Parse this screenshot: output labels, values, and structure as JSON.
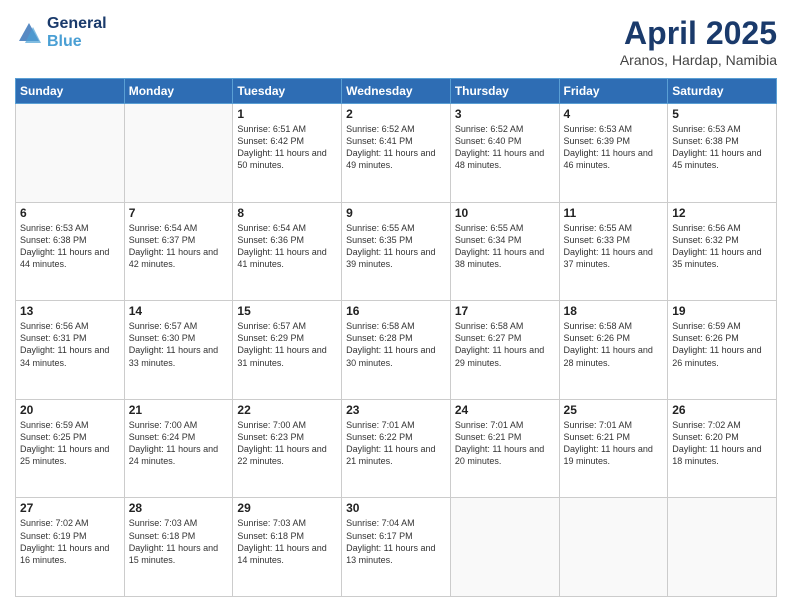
{
  "header": {
    "logo_line1": "General",
    "logo_line2": "Blue",
    "month_title": "April 2025",
    "subtitle": "Aranos, Hardap, Namibia"
  },
  "days_of_week": [
    "Sunday",
    "Monday",
    "Tuesday",
    "Wednesday",
    "Thursday",
    "Friday",
    "Saturday"
  ],
  "weeks": [
    [
      {
        "day": "",
        "sunrise": "",
        "sunset": "",
        "daylight": ""
      },
      {
        "day": "",
        "sunrise": "",
        "sunset": "",
        "daylight": ""
      },
      {
        "day": "1",
        "sunrise": "Sunrise: 6:51 AM",
        "sunset": "Sunset: 6:42 PM",
        "daylight": "Daylight: 11 hours and 50 minutes."
      },
      {
        "day": "2",
        "sunrise": "Sunrise: 6:52 AM",
        "sunset": "Sunset: 6:41 PM",
        "daylight": "Daylight: 11 hours and 49 minutes."
      },
      {
        "day": "3",
        "sunrise": "Sunrise: 6:52 AM",
        "sunset": "Sunset: 6:40 PM",
        "daylight": "Daylight: 11 hours and 48 minutes."
      },
      {
        "day": "4",
        "sunrise": "Sunrise: 6:53 AM",
        "sunset": "Sunset: 6:39 PM",
        "daylight": "Daylight: 11 hours and 46 minutes."
      },
      {
        "day": "5",
        "sunrise": "Sunrise: 6:53 AM",
        "sunset": "Sunset: 6:38 PM",
        "daylight": "Daylight: 11 hours and 45 minutes."
      }
    ],
    [
      {
        "day": "6",
        "sunrise": "Sunrise: 6:53 AM",
        "sunset": "Sunset: 6:38 PM",
        "daylight": "Daylight: 11 hours and 44 minutes."
      },
      {
        "day": "7",
        "sunrise": "Sunrise: 6:54 AM",
        "sunset": "Sunset: 6:37 PM",
        "daylight": "Daylight: 11 hours and 42 minutes."
      },
      {
        "day": "8",
        "sunrise": "Sunrise: 6:54 AM",
        "sunset": "Sunset: 6:36 PM",
        "daylight": "Daylight: 11 hours and 41 minutes."
      },
      {
        "day": "9",
        "sunrise": "Sunrise: 6:55 AM",
        "sunset": "Sunset: 6:35 PM",
        "daylight": "Daylight: 11 hours and 39 minutes."
      },
      {
        "day": "10",
        "sunrise": "Sunrise: 6:55 AM",
        "sunset": "Sunset: 6:34 PM",
        "daylight": "Daylight: 11 hours and 38 minutes."
      },
      {
        "day": "11",
        "sunrise": "Sunrise: 6:55 AM",
        "sunset": "Sunset: 6:33 PM",
        "daylight": "Daylight: 11 hours and 37 minutes."
      },
      {
        "day": "12",
        "sunrise": "Sunrise: 6:56 AM",
        "sunset": "Sunset: 6:32 PM",
        "daylight": "Daylight: 11 hours and 35 minutes."
      }
    ],
    [
      {
        "day": "13",
        "sunrise": "Sunrise: 6:56 AM",
        "sunset": "Sunset: 6:31 PM",
        "daylight": "Daylight: 11 hours and 34 minutes."
      },
      {
        "day": "14",
        "sunrise": "Sunrise: 6:57 AM",
        "sunset": "Sunset: 6:30 PM",
        "daylight": "Daylight: 11 hours and 33 minutes."
      },
      {
        "day": "15",
        "sunrise": "Sunrise: 6:57 AM",
        "sunset": "Sunset: 6:29 PM",
        "daylight": "Daylight: 11 hours and 31 minutes."
      },
      {
        "day": "16",
        "sunrise": "Sunrise: 6:58 AM",
        "sunset": "Sunset: 6:28 PM",
        "daylight": "Daylight: 11 hours and 30 minutes."
      },
      {
        "day": "17",
        "sunrise": "Sunrise: 6:58 AM",
        "sunset": "Sunset: 6:27 PM",
        "daylight": "Daylight: 11 hours and 29 minutes."
      },
      {
        "day": "18",
        "sunrise": "Sunrise: 6:58 AM",
        "sunset": "Sunset: 6:26 PM",
        "daylight": "Daylight: 11 hours and 28 minutes."
      },
      {
        "day": "19",
        "sunrise": "Sunrise: 6:59 AM",
        "sunset": "Sunset: 6:26 PM",
        "daylight": "Daylight: 11 hours and 26 minutes."
      }
    ],
    [
      {
        "day": "20",
        "sunrise": "Sunrise: 6:59 AM",
        "sunset": "Sunset: 6:25 PM",
        "daylight": "Daylight: 11 hours and 25 minutes."
      },
      {
        "day": "21",
        "sunrise": "Sunrise: 7:00 AM",
        "sunset": "Sunset: 6:24 PM",
        "daylight": "Daylight: 11 hours and 24 minutes."
      },
      {
        "day": "22",
        "sunrise": "Sunrise: 7:00 AM",
        "sunset": "Sunset: 6:23 PM",
        "daylight": "Daylight: 11 hours and 22 minutes."
      },
      {
        "day": "23",
        "sunrise": "Sunrise: 7:01 AM",
        "sunset": "Sunset: 6:22 PM",
        "daylight": "Daylight: 11 hours and 21 minutes."
      },
      {
        "day": "24",
        "sunrise": "Sunrise: 7:01 AM",
        "sunset": "Sunset: 6:21 PM",
        "daylight": "Daylight: 11 hours and 20 minutes."
      },
      {
        "day": "25",
        "sunrise": "Sunrise: 7:01 AM",
        "sunset": "Sunset: 6:21 PM",
        "daylight": "Daylight: 11 hours and 19 minutes."
      },
      {
        "day": "26",
        "sunrise": "Sunrise: 7:02 AM",
        "sunset": "Sunset: 6:20 PM",
        "daylight": "Daylight: 11 hours and 18 minutes."
      }
    ],
    [
      {
        "day": "27",
        "sunrise": "Sunrise: 7:02 AM",
        "sunset": "Sunset: 6:19 PM",
        "daylight": "Daylight: 11 hours and 16 minutes."
      },
      {
        "day": "28",
        "sunrise": "Sunrise: 7:03 AM",
        "sunset": "Sunset: 6:18 PM",
        "daylight": "Daylight: 11 hours and 15 minutes."
      },
      {
        "day": "29",
        "sunrise": "Sunrise: 7:03 AM",
        "sunset": "Sunset: 6:18 PM",
        "daylight": "Daylight: 11 hours and 14 minutes."
      },
      {
        "day": "30",
        "sunrise": "Sunrise: 7:04 AM",
        "sunset": "Sunset: 6:17 PM",
        "daylight": "Daylight: 11 hours and 13 minutes."
      },
      {
        "day": "",
        "sunrise": "",
        "sunset": "",
        "daylight": ""
      },
      {
        "day": "",
        "sunrise": "",
        "sunset": "",
        "daylight": ""
      },
      {
        "day": "",
        "sunrise": "",
        "sunset": "",
        "daylight": ""
      }
    ]
  ]
}
